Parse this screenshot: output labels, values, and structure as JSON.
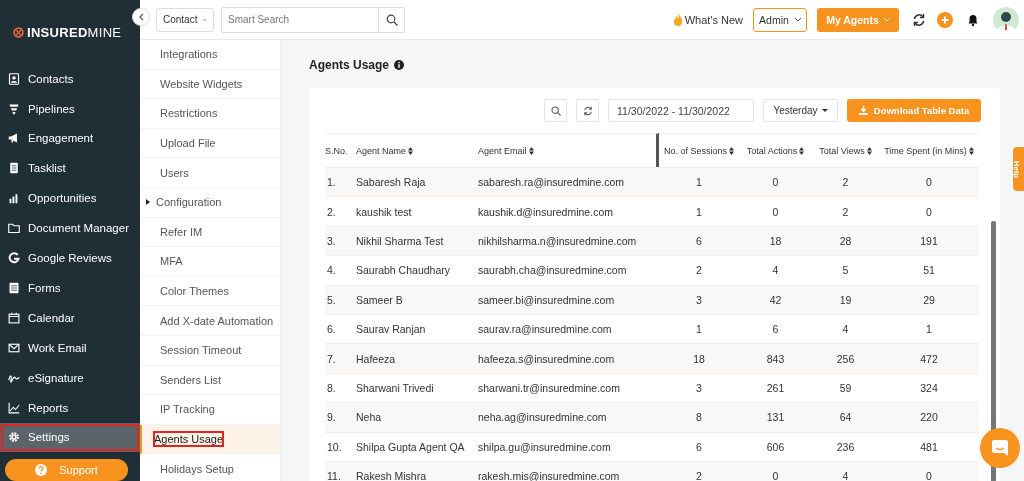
{
  "brand": {
    "bold": "INSURED",
    "light": "MINE"
  },
  "sidebar": {
    "items": [
      {
        "label": "Contacts",
        "kind": "contacts",
        "selected": false,
        "marked": false
      },
      {
        "label": "Pipelines",
        "kind": "funnel",
        "selected": false,
        "marked": false
      },
      {
        "label": "Engagement",
        "kind": "megaphone",
        "selected": false,
        "marked": false
      },
      {
        "label": "Tasklist",
        "kind": "list",
        "selected": false,
        "marked": false
      },
      {
        "label": "Opportunities",
        "kind": "bars",
        "selected": false,
        "marked": false
      },
      {
        "label": "Document Manager",
        "kind": "folder",
        "selected": false,
        "marked": false
      },
      {
        "label": "Google Reviews",
        "kind": "g",
        "selected": false,
        "marked": false
      },
      {
        "label": "Forms",
        "kind": "form",
        "selected": false,
        "marked": false
      },
      {
        "label": "Calendar",
        "kind": "calendar",
        "selected": false,
        "marked": false
      },
      {
        "label": "Work Email",
        "kind": "mail",
        "selected": false,
        "marked": false
      },
      {
        "label": "eSignature",
        "kind": "sign",
        "selected": false,
        "marked": false
      },
      {
        "label": "Reports",
        "kind": "chart",
        "selected": false,
        "marked": false
      },
      {
        "label": "Settings",
        "kind": "gear",
        "selected": true,
        "marked": true
      }
    ],
    "support": "Support"
  },
  "topbar": {
    "scope": "Contact",
    "search": {
      "placeholder": "Smart Search"
    },
    "whats_new": "What's New",
    "role": "Admin",
    "my_agents": "My Agents"
  },
  "submenu": {
    "items": [
      {
        "label": "Integrations",
        "selected": false,
        "marked": false,
        "expandable": false
      },
      {
        "label": "Website Widgets",
        "selected": false,
        "marked": false,
        "expandable": false
      },
      {
        "label": "Restrictions",
        "selected": false,
        "marked": false,
        "expandable": false
      },
      {
        "label": "Upload File",
        "selected": false,
        "marked": false,
        "expandable": false
      },
      {
        "label": "Users",
        "selected": false,
        "marked": false,
        "expandable": false
      },
      {
        "label": "Configuration",
        "selected": false,
        "marked": false,
        "expandable": true
      },
      {
        "label": "Refer IM",
        "selected": false,
        "marked": false,
        "expandable": false
      },
      {
        "label": "MFA",
        "selected": false,
        "marked": false,
        "expandable": false
      },
      {
        "label": "Color Themes",
        "selected": false,
        "marked": false,
        "expandable": false
      },
      {
        "label": "Add X-date Automation",
        "selected": false,
        "marked": false,
        "expandable": false
      },
      {
        "label": "Session Timeout",
        "selected": false,
        "marked": false,
        "expandable": false
      },
      {
        "label": "Senders List",
        "selected": false,
        "marked": false,
        "expandable": false
      },
      {
        "label": "IP Tracking",
        "selected": false,
        "marked": false,
        "expandable": false
      },
      {
        "label": "Agents Usage",
        "selected": true,
        "marked": true,
        "expandable": false
      },
      {
        "label": "Holidays Setup",
        "selected": false,
        "marked": false,
        "expandable": false
      }
    ]
  },
  "page": {
    "title": "Agents Usage",
    "date_range": "11/30/2022 - 11/30/2022",
    "period": "Yesterday",
    "download": "Download Table Data"
  },
  "table": {
    "columns": [
      "S.No.",
      "Agent Name",
      "Agent Email",
      "No. of Sessions",
      "Total Actions",
      "Total Views",
      "Time Spent (in Mins)"
    ],
    "rows": [
      [
        "1.",
        "Sabaresh Raja",
        "sabaresh.ra@insuredmine.com",
        "1",
        "0",
        "2",
        "0"
      ],
      [
        "2.",
        "kaushik test",
        "kaushik.d@insuredmine.com",
        "1",
        "0",
        "2",
        "0"
      ],
      [
        "3.",
        "Nikhil Sharma Test",
        "nikhilsharma.n@insuredmine.com",
        "6",
        "18",
        "28",
        "191"
      ],
      [
        "4.",
        "Saurabh Chaudhary",
        "saurabh.cha@insuredmine.com",
        "2",
        "4",
        "5",
        "51"
      ],
      [
        "5.",
        "Sameer B",
        "sameer.bi@insuredmine.com",
        "3",
        "42",
        "19",
        "29"
      ],
      [
        "6.",
        "Saurav Ranjan",
        "saurav.ra@insuredmine.com",
        "1",
        "6",
        "4",
        "1"
      ],
      [
        "7.",
        "Hafeeza",
        "hafeeza.s@insuredmine.com",
        "18",
        "843",
        "256",
        "472"
      ],
      [
        "8.",
        "Sharwani Trivedi",
        "sharwani.tr@insuredmine.com",
        "3",
        "261",
        "59",
        "324"
      ],
      [
        "9.",
        "Neha",
        "neha.ag@insuredmine.com",
        "8",
        "131",
        "64",
        "220"
      ],
      [
        "10.",
        "Shilpa Gupta Agent QA",
        "shilpa.gu@insuredmine.com",
        "6",
        "606",
        "236",
        "481"
      ],
      [
        "11.",
        "Rakesh Mishra",
        "rakesh.mis@insuredmine.com",
        "2",
        "0",
        "4",
        "0"
      ]
    ]
  },
  "help_tab": "Help"
}
